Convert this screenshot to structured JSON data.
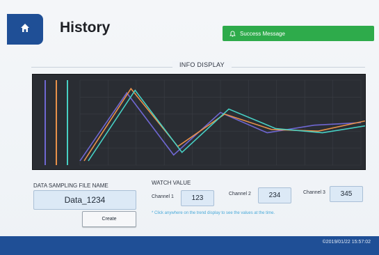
{
  "header": {
    "title": "History",
    "home_icon": "home-icon",
    "toast": {
      "text": "Success Message",
      "icon": "bell-icon",
      "color": "#2eab4b"
    }
  },
  "info": {
    "title": "INFO DISPLAY"
  },
  "chart_data": {
    "type": "line",
    "x": [
      0,
      1,
      2,
      3,
      4,
      5,
      6
    ],
    "series": [
      {
        "color": "#6f67d2",
        "values": [
          0.05,
          0.85,
          0.12,
          0.62,
          0.38,
          0.47,
          0.5
        ]
      },
      {
        "color": "#e8914a",
        "values": [
          0.05,
          0.9,
          0.22,
          0.6,
          0.42,
          0.4,
          0.52
        ]
      },
      {
        "color": "#47d0c4",
        "values": [
          0.05,
          0.88,
          0.15,
          0.66,
          0.43,
          0.38,
          0.47
        ]
      }
    ],
    "grid": true
  },
  "form": {
    "file_label": "DATA SAMPLING FILE NAME",
    "file_value": "Data_1234",
    "create_label": "Create",
    "watch_label": "WATCH VALUE",
    "channels": [
      {
        "label": "Channel 1",
        "value": "123"
      },
      {
        "label": "Channel 2",
        "value": "234"
      },
      {
        "label": "Channel 3",
        "value": "345"
      }
    ],
    "hint": "* Click anywhere on the trend display to see the values at the time."
  },
  "footer": {
    "timestamp": "©2019/01/22 15:57:02",
    "color": "#1f4f96"
  }
}
